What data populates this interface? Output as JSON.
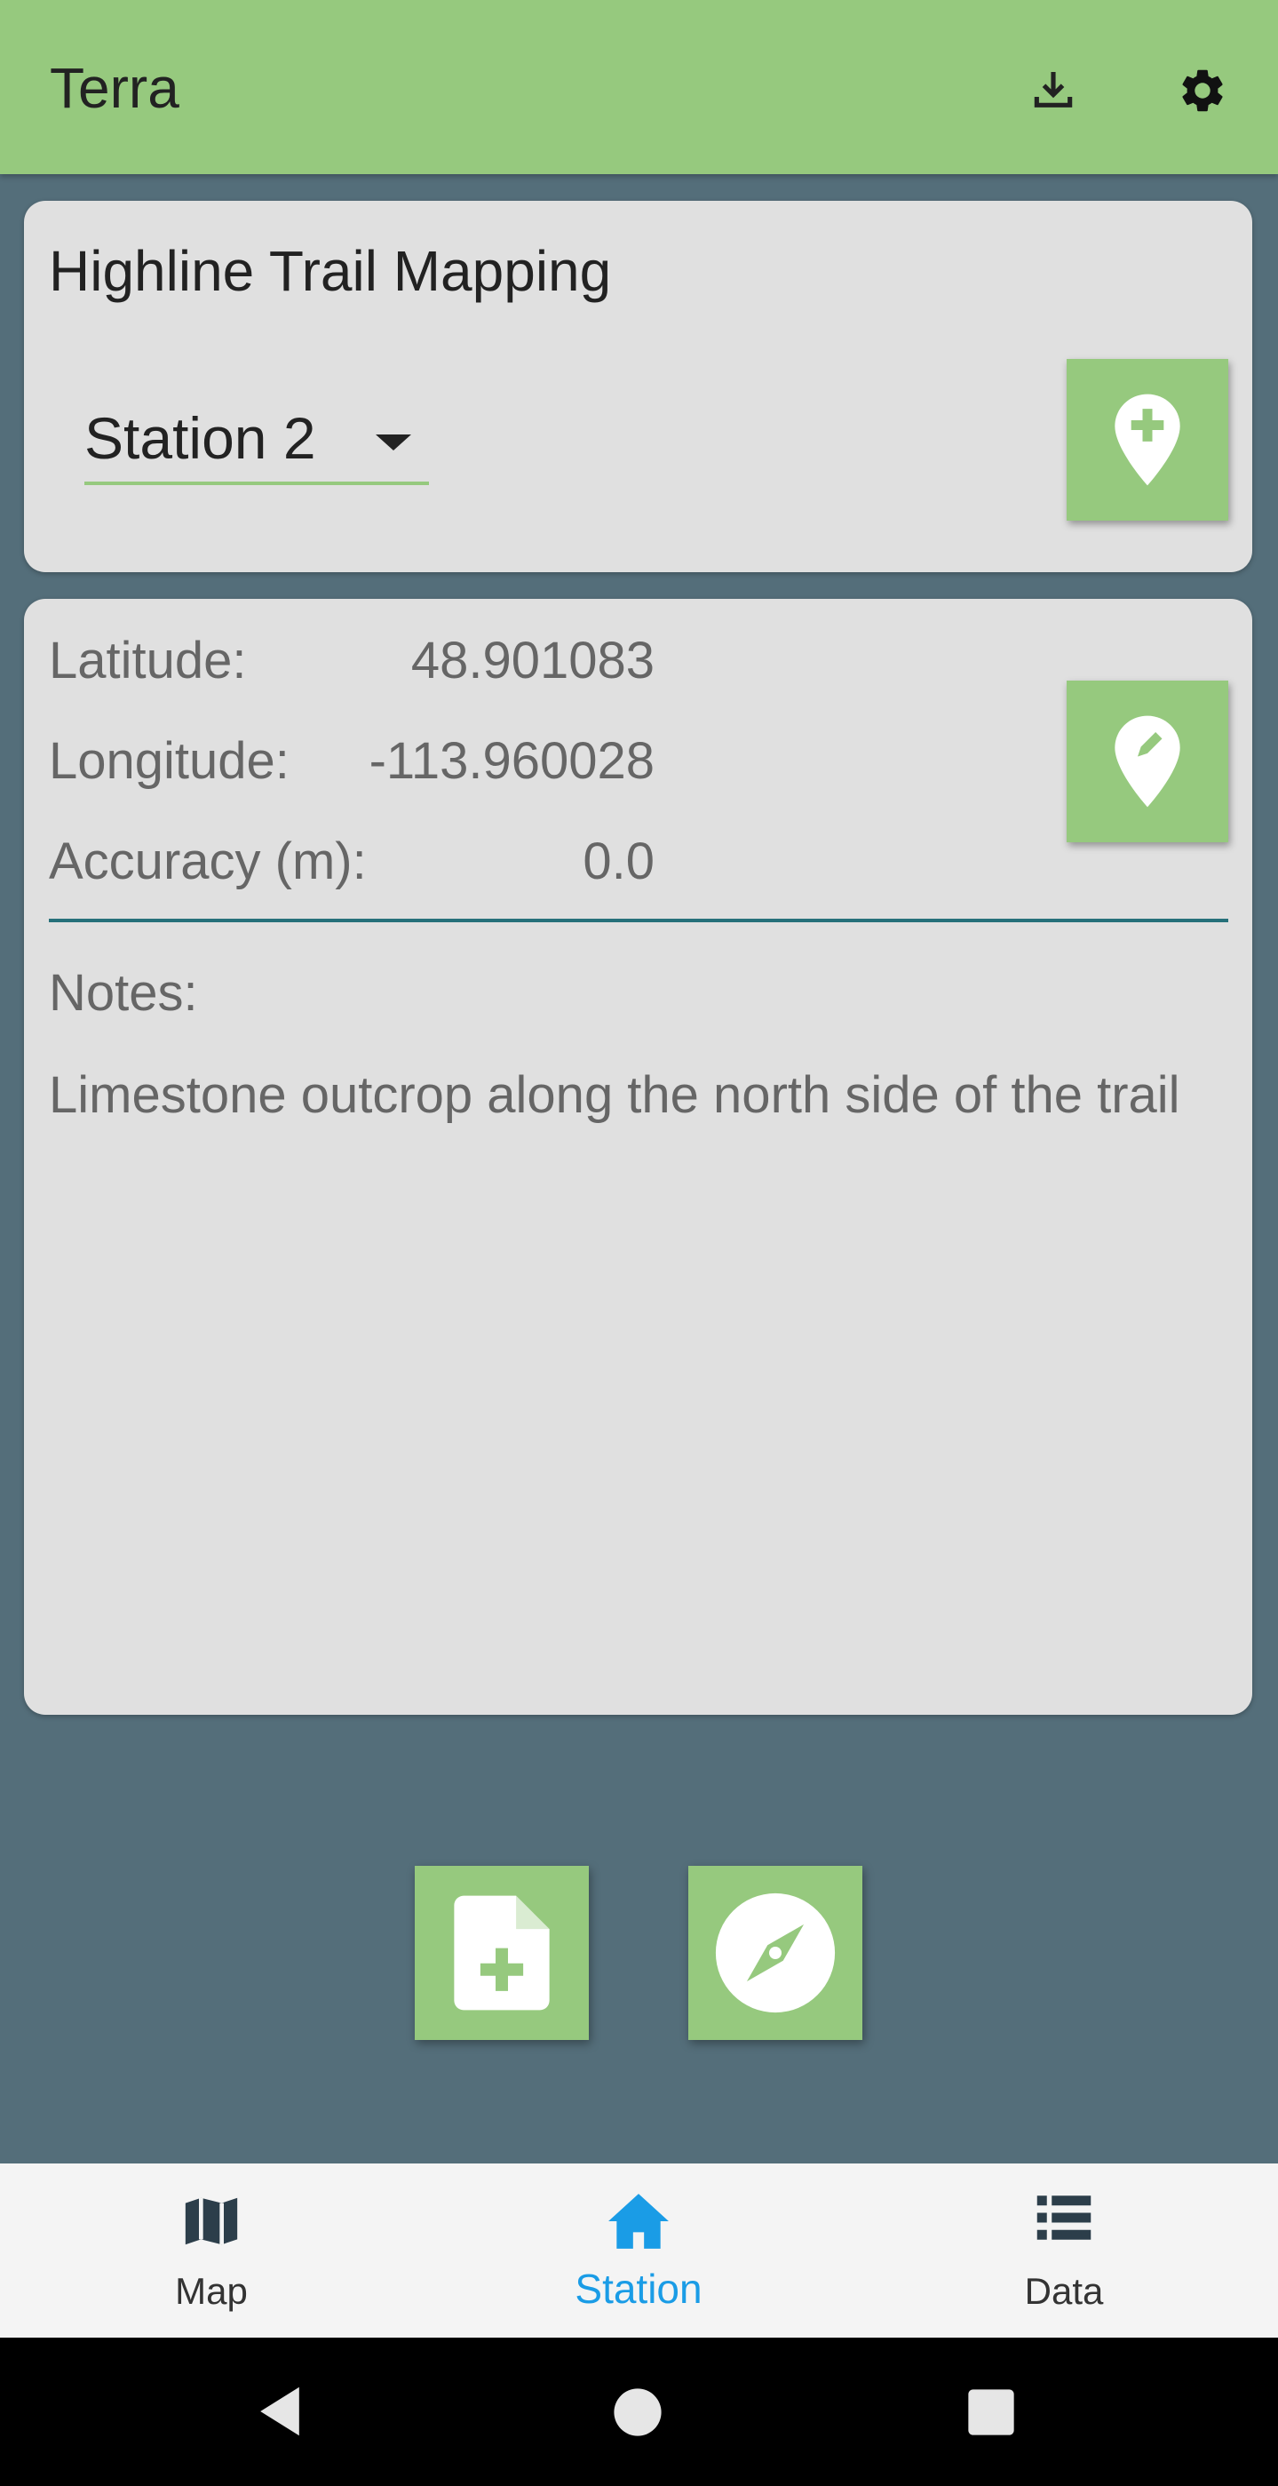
{
  "app": {
    "title": "Terra",
    "colors": {
      "accent": "#96c97e",
      "background": "#546e7a",
      "active_nav": "#1a9ce6"
    },
    "actions": [
      {
        "icon": "download-icon"
      },
      {
        "icon": "gear-icon"
      }
    ]
  },
  "project": {
    "name": "Highline Trail Mapping",
    "station_selected": "Station 2",
    "add_station_icon": "add-location-icon"
  },
  "location": {
    "latitude_label": "Latitude:",
    "latitude_value": "48.901083",
    "longitude_label": "Longitude:",
    "longitude_value": "-113.960028",
    "accuracy_label": "Accuracy (m):",
    "accuracy_value": "0.0",
    "edit_icon": "edit-location-icon",
    "notes_label": "Notes:",
    "notes_text": "Limestone outcrop along the north side of the trail"
  },
  "fabs": [
    {
      "icon": "add-document-icon"
    },
    {
      "icon": "compass-icon"
    }
  ],
  "nav": {
    "items": [
      {
        "label": "Map",
        "icon": "map-icon"
      },
      {
        "label": "Station",
        "icon": "home-icon",
        "active": true
      },
      {
        "label": "Data",
        "icon": "list-icon"
      }
    ]
  },
  "system_nav": [
    {
      "icon": "back-icon"
    },
    {
      "icon": "home-circle-icon"
    },
    {
      "icon": "recents-icon"
    }
  ]
}
